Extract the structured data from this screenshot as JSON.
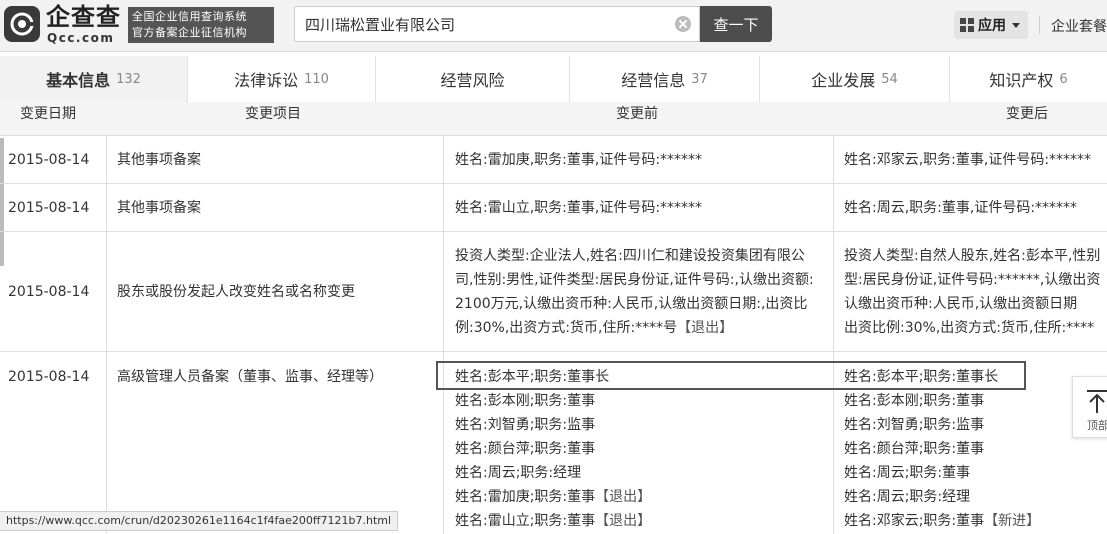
{
  "header": {
    "logo_name": "企查查",
    "logo_domain": "Qcc.com",
    "slogan_line1": "全国企业信用查询系统",
    "slogan_line2": "官方备案企业征信机构",
    "search_value": "四川瑞松置业有限公司",
    "search_button": "查一下",
    "apps_label": "应用",
    "header_link": "企业套餐"
  },
  "tabs": [
    {
      "label": "基本信息",
      "count": "132",
      "active": true
    },
    {
      "label": "法律诉讼",
      "count": "110"
    },
    {
      "label": "经营风险",
      "count": ""
    },
    {
      "label": "经营信息",
      "count": "37"
    },
    {
      "label": "企业发展",
      "count": "54"
    },
    {
      "label": "知识产权",
      "count": "6"
    }
  ],
  "table": {
    "headers": {
      "date": "变更日期",
      "item": "变更项目",
      "before": "变更前",
      "after": "变更后"
    },
    "rows": [
      {
        "date": "2015-08-14",
        "item": "其他事项备案",
        "before": "姓名:雷加庚,职务:董事,证件号码:******",
        "after": "姓名:邓家云,职务:董事,证件号码:******"
      },
      {
        "date": "2015-08-14",
        "item": "其他事项备案",
        "before": "姓名:雷山立,职务:董事,证件号码:******",
        "after": "姓名:周云,职务:董事,证件号码:******"
      },
      {
        "date": "2015-08-14",
        "item": "股东或股份发起人改变姓名或名称变更",
        "before": "投资人类型:企业法人,姓名:四川仁和建设投资集团有限公司,性别:男性,证件类型:居民身份证,证件号码:,认缴出资额:2100万元,认缴出资币种:人民币,认缴出资额日期:,出资比例:30%,出资方式:货币,住所:****号",
        "before_tag": "【退出】",
        "after_lines": [
          "投资人类型:自然人股东,姓名:彭本平,性别",
          "型:居民身份证,证件号码:******,认缴出资",
          "认缴出资币种:人民币,认缴出资额日期",
          "出资比例:30%,出资方式:货币,住所:****"
        ]
      },
      {
        "date": "2015-08-14",
        "item": "高级管理人员备案（董事、监事、经理等）",
        "before_lines": [
          {
            "text": "姓名:彭本平;职务:董事长",
            "tag": ""
          },
          {
            "text": "姓名:彭本刚;职务:董事",
            "tag": ""
          },
          {
            "text": "姓名:刘智勇;职务:监事",
            "tag": ""
          },
          {
            "text": "姓名:颜台萍;职务:董事",
            "tag": ""
          },
          {
            "text": "姓名:周云;职务:经理",
            "tag": ""
          },
          {
            "text": "姓名:雷加庚;职务:董事",
            "tag": "【退出】"
          },
          {
            "text": "姓名:雷山立;职务:董事",
            "tag": "【退出】"
          }
        ],
        "after_lines": [
          {
            "text": "姓名:彭本平;职务:董事长",
            "tag": ""
          },
          {
            "text": "姓名:彭本刚;职务:董事",
            "tag": ""
          },
          {
            "text": "姓名:刘智勇;职务:监事",
            "tag": ""
          },
          {
            "text": "姓名:颜台萍;职务:董事",
            "tag": ""
          },
          {
            "text": "姓名:周云;职务:董事",
            "tag": ""
          },
          {
            "text": "姓名:周云;职务:经理",
            "tag": ""
          },
          {
            "text": "姓名:邓家云;职务:董事",
            "tag": "【新进】"
          }
        ]
      }
    ]
  },
  "back_to_top": {
    "label": "顶部"
  },
  "status_url": "https://www.qcc.com/crun/d20230261e1164c1f4fae200ff7121b7.html"
}
